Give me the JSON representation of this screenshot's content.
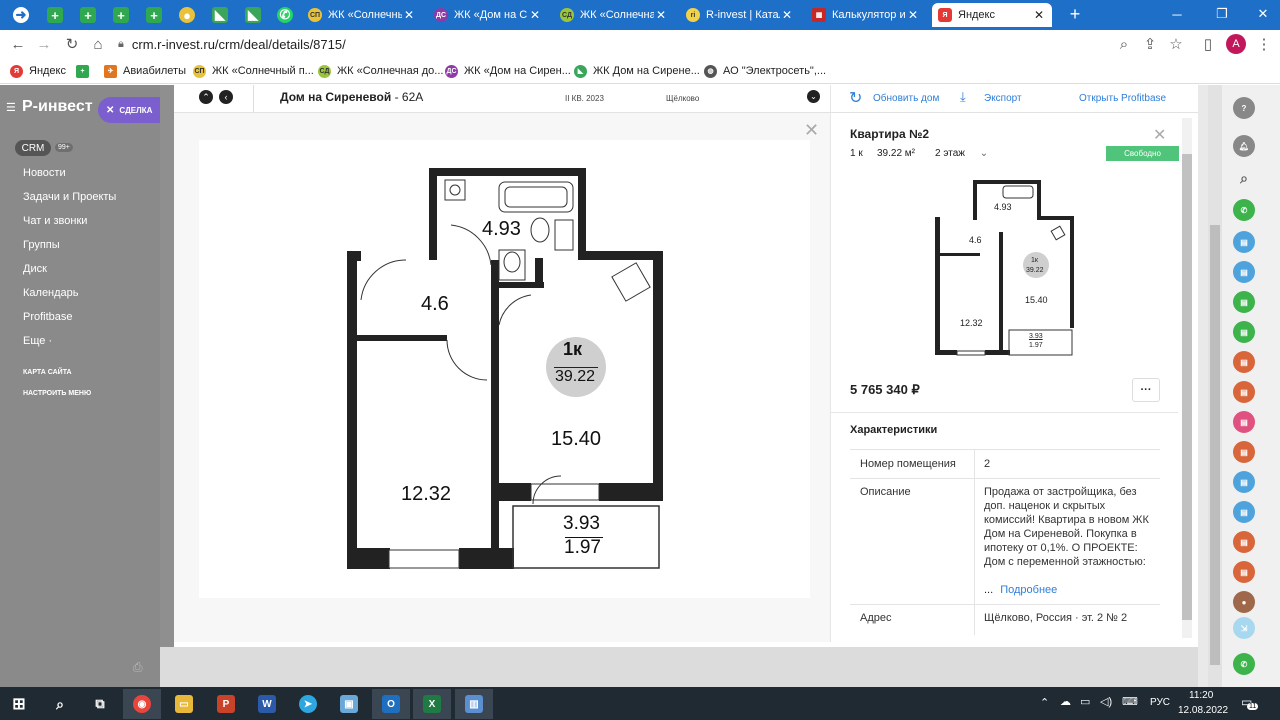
{
  "browser": {
    "tabs": [
      {
        "label": "ЖК «Солнечный",
        "icon": "sp"
      },
      {
        "label": "ЖК «Дом на Си",
        "icon": "ds"
      },
      {
        "label": "ЖК «Солнечная",
        "icon": "sd"
      },
      {
        "label": "R-invest | Катал",
        "icon": "ri"
      },
      {
        "label": "Калькулятор ип",
        "icon": "calc"
      },
      {
        "label": "Яндекс",
        "icon": "ya"
      }
    ],
    "url": "crm.r-invest.ru/crm/deal/details/8715/",
    "profile_initial": "A",
    "bookmarks": [
      {
        "label": "Яндекс"
      },
      {
        "label": "Авиабилеты"
      },
      {
        "label": "ЖК «Солнечный п..."
      },
      {
        "label": "ЖК «Солнечная до..."
      },
      {
        "label": "ЖК «Дом на Сирен..."
      },
      {
        "label": "ЖК Дом на Сирене..."
      },
      {
        "label": "АО \"Электросеть\",..."
      }
    ]
  },
  "sidebar": {
    "logo": "Р-инвест",
    "deal_badge": "СДЕЛКА",
    "crm": "CRM",
    "crm_count": "99+",
    "items": [
      "Новости",
      "Задачи и Проекты",
      "Чат и звонки",
      "Группы",
      "Диск",
      "Календарь",
      "Profitbase",
      "Еще ·"
    ],
    "small_links": [
      "КАРТА САЙТА",
      "НАСТРОИТЬ МЕНЮ"
    ]
  },
  "header": {
    "house_name": "Дом на Сиреневой",
    "house_num": "- 62А",
    "quarter": "II КВ. 2023",
    "city": "Щёлково",
    "refresh": "Обновить дом",
    "export": "Экспорт",
    "open_pb": "Открыть Profitbase"
  },
  "plan": {
    "areas": {
      "bath": "4.93",
      "hall": "4.6",
      "bedroom": "12.32",
      "living": "15.40",
      "balcony_top": "3.93",
      "balcony_bottom": "1.97"
    },
    "badge_rooms": "1к",
    "badge_area": "39.22"
  },
  "details": {
    "title": "Квартира №2",
    "rooms": "1 к",
    "area": "39.22 м²",
    "floor": "2 этаж",
    "status": "Свободно",
    "price": "5 765 340 ₽",
    "more": "···",
    "section_title": "Характеристики",
    "rows": [
      {
        "k": "Номер помещения",
        "v": "2"
      },
      {
        "k": "Описание",
        "v": "Продажа от застройщика, без доп. наценок и скрытых комиссий! Квартира в новом ЖК Дом на Сиреневой. Покупка в ипотеку от 0,1%. О ПРОЕКТЕ: Дом с переменной этажностью:"
      },
      {
        "k": "Адрес",
        "v": "Щёлково, Россия · эт. 2 № 2"
      }
    ],
    "more_link": "Подробнее",
    "ellipsis": "..."
  },
  "taskbar": {
    "time": "11:20",
    "date": "12.08.2022",
    "lang": "РУС",
    "notif_count": "11"
  }
}
